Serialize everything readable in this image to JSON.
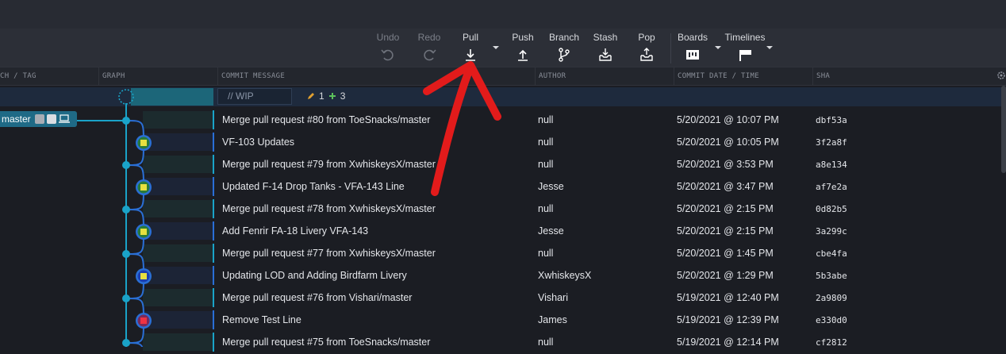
{
  "toolbar": {
    "undo": "Undo",
    "redo": "Redo",
    "pull": "Pull",
    "push": "Push",
    "branch": "Branch",
    "stash": "Stash",
    "pop": "Pop",
    "boards": "Boards",
    "timelines": "Timelines"
  },
  "columns": {
    "branch_tag": "CH / TAG",
    "graph": "GRAPH",
    "commit_message": "COMMIT MESSAGE",
    "author": "AUTHOR",
    "commit_date": "COMMIT DATE / TIME",
    "sha": "SHA"
  },
  "wip": {
    "placeholder": "// WIP",
    "modified_count": "1",
    "added_count": "3"
  },
  "branch": {
    "name": "master"
  },
  "commits": [
    {
      "message": "Merge pull request #80 from ToeSnacks/master",
      "author": "null",
      "date": "5/20/2021 @ 10:07 PM",
      "sha": "dbf53a"
    },
    {
      "message": "VF-103 Updates",
      "author": "null",
      "date": "5/20/2021 @ 10:05 PM",
      "sha": "3f2a8f"
    },
    {
      "message": "Merge pull request #79 from XwhiskeysX/master",
      "author": "null",
      "date": "5/20/2021 @ 3:53 PM",
      "sha": "a8e134"
    },
    {
      "message": "Updated F-14 Drop Tanks - VFA-143 Line",
      "author": "Jesse",
      "date": "5/20/2021 @ 3:47 PM",
      "sha": "af7e2a"
    },
    {
      "message": "Merge pull request #78 from XwhiskeysX/master",
      "author": "null",
      "date": "5/20/2021 @ 2:15 PM",
      "sha": "0d82b5"
    },
    {
      "message": "Add Fenrir FA-18 Livery VFA-143",
      "author": "Jesse",
      "date": "5/20/2021 @ 2:15 PM",
      "sha": "3a299c"
    },
    {
      "message": "Merge pull request #77 from XwhiskeysX/master",
      "author": "null",
      "date": "5/20/2021 @ 1:45 PM",
      "sha": "cbe4fa"
    },
    {
      "message": "Updating LOD and Adding Birdfarm Livery",
      "author": "XwhiskeysX",
      "date": "5/20/2021 @ 1:29 PM",
      "sha": "5b3abe"
    },
    {
      "message": "Merge pull request #76 from Vishari/master",
      "author": "Vishari",
      "date": "5/19/2021 @ 12:40 PM",
      "sha": "2a9809"
    },
    {
      "message": "Remove Test Line",
      "author": "James",
      "date": "5/19/2021 @ 12:39 PM",
      "sha": "e330d0"
    },
    {
      "message": "Merge pull request #75 from ToeSnacks/master",
      "author": "null",
      "date": "5/19/2021 @ 12:14 PM",
      "sha": "cf2812"
    }
  ],
  "colors": {
    "lane_main": "#1aa3c8",
    "lane_feature": "#2a6fd6",
    "wip_highlight": "#1e2a3d",
    "annotation_arrow": "#e21b1b"
  }
}
